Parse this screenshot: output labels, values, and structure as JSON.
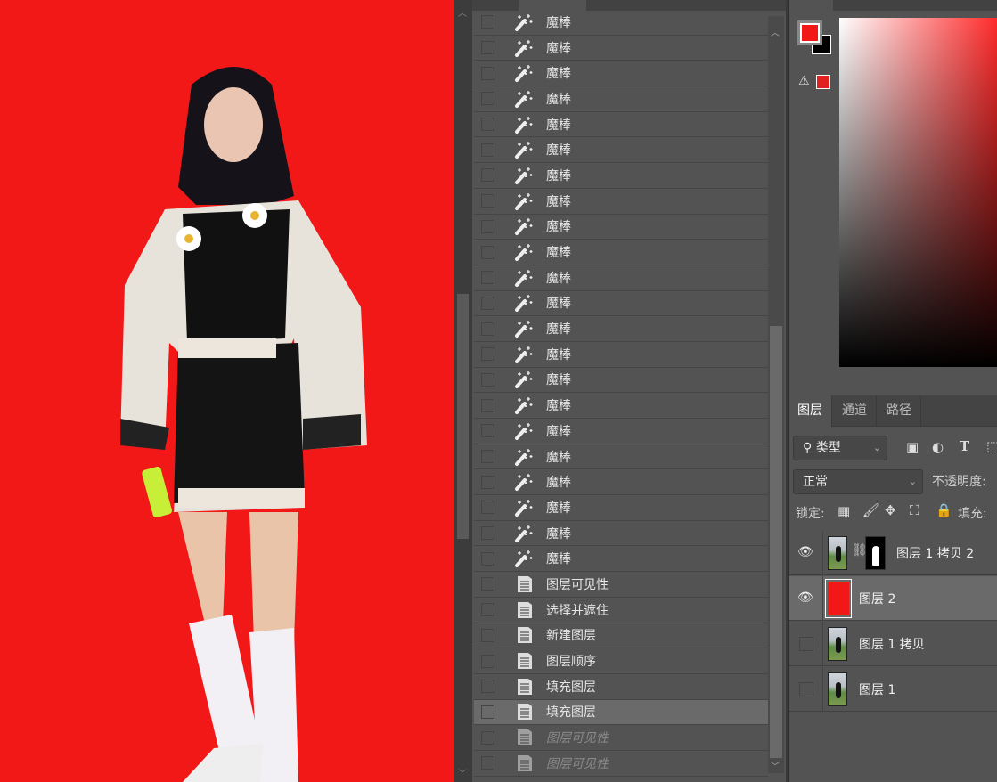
{
  "history": {
    "items": [
      {
        "label": "魔棒",
        "icon": "magic-wand-icon",
        "state": "normal"
      },
      {
        "label": "魔棒",
        "icon": "magic-wand-icon",
        "state": "normal"
      },
      {
        "label": "魔棒",
        "icon": "magic-wand-icon",
        "state": "normal"
      },
      {
        "label": "魔棒",
        "icon": "magic-wand-icon",
        "state": "normal"
      },
      {
        "label": "魔棒",
        "icon": "magic-wand-icon",
        "state": "normal"
      },
      {
        "label": "魔棒",
        "icon": "magic-wand-icon",
        "state": "normal"
      },
      {
        "label": "魔棒",
        "icon": "magic-wand-icon",
        "state": "normal"
      },
      {
        "label": "魔棒",
        "icon": "magic-wand-icon",
        "state": "normal"
      },
      {
        "label": "魔棒",
        "icon": "magic-wand-icon",
        "state": "normal"
      },
      {
        "label": "魔棒",
        "icon": "magic-wand-icon",
        "state": "normal"
      },
      {
        "label": "魔棒",
        "icon": "magic-wand-icon",
        "state": "normal"
      },
      {
        "label": "魔棒",
        "icon": "magic-wand-icon",
        "state": "normal"
      },
      {
        "label": "魔棒",
        "icon": "magic-wand-icon",
        "state": "normal"
      },
      {
        "label": "魔棒",
        "icon": "magic-wand-icon",
        "state": "normal"
      },
      {
        "label": "魔棒",
        "icon": "magic-wand-icon",
        "state": "normal"
      },
      {
        "label": "魔棒",
        "icon": "magic-wand-icon",
        "state": "normal"
      },
      {
        "label": "魔棒",
        "icon": "magic-wand-icon",
        "state": "normal"
      },
      {
        "label": "魔棒",
        "icon": "magic-wand-icon",
        "state": "normal"
      },
      {
        "label": "魔棒",
        "icon": "magic-wand-icon",
        "state": "normal"
      },
      {
        "label": "魔棒",
        "icon": "magic-wand-icon",
        "state": "normal"
      },
      {
        "label": "魔棒",
        "icon": "magic-wand-icon",
        "state": "normal"
      },
      {
        "label": "魔棒",
        "icon": "magic-wand-icon",
        "state": "normal"
      },
      {
        "label": "图层可见性",
        "icon": "document-icon",
        "state": "normal"
      },
      {
        "label": "选择并遮住",
        "icon": "document-icon",
        "state": "normal"
      },
      {
        "label": "新建图层",
        "icon": "document-icon",
        "state": "normal"
      },
      {
        "label": "图层顺序",
        "icon": "document-icon",
        "state": "normal"
      },
      {
        "label": "填充图层",
        "icon": "document-icon",
        "state": "normal"
      },
      {
        "label": "填充图层",
        "icon": "document-icon",
        "state": "selected"
      },
      {
        "label": "图层可见性",
        "icon": "document-icon",
        "state": "undone"
      },
      {
        "label": "图层可见性",
        "icon": "document-icon",
        "state": "undone"
      }
    ]
  },
  "colors": {
    "foreground": "#f21818",
    "background": "#000000",
    "canvas": "#f21818"
  },
  "layers_panel": {
    "tabs": [
      "图层",
      "通道",
      "路径"
    ],
    "filter": {
      "label": "类型"
    },
    "blend_mode": "正常",
    "opacity_label": "不透明度:",
    "lock_label": "锁定:",
    "fill_label": "填充:",
    "layers": [
      {
        "name": "图层 1 拷贝 2",
        "visible": true,
        "has_mask": true,
        "selected": false,
        "thumb": "photo"
      },
      {
        "name": "图层 2",
        "visible": true,
        "has_mask": false,
        "selected": true,
        "thumb": "red"
      },
      {
        "name": "图层 1 拷贝",
        "visible": false,
        "has_mask": false,
        "selected": false,
        "thumb": "photo"
      },
      {
        "name": "图层 1",
        "visible": false,
        "has_mask": false,
        "selected": false,
        "thumb": "photo"
      }
    ]
  }
}
